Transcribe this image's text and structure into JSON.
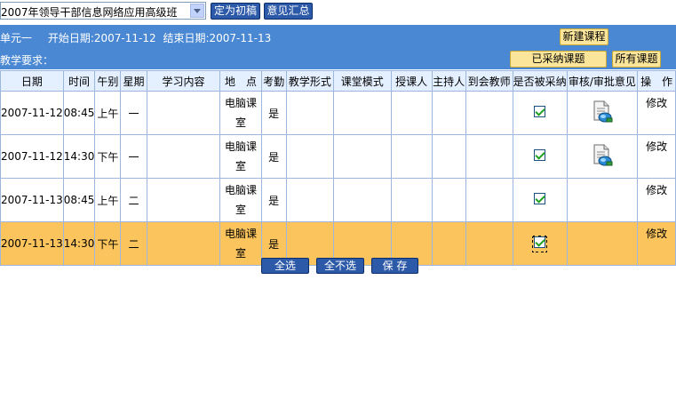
{
  "toolbar": {
    "class_select_value": "2007年领导干部信息网络应用高级班",
    "finalize_label": "定为初稿",
    "summary_label": "意见汇总"
  },
  "header": {
    "unit": "单元一",
    "start_label": "开始日期:2007-11-12",
    "end_label": "结束日期:2007-11-13",
    "requirement_label": "教学要求：",
    "new_course_label": "新建课程",
    "adopted_label": "已采纳课题",
    "all_label": "所有课题"
  },
  "table": {
    "columns": [
      "日期",
      "时间",
      "午别",
      "星期",
      "学习内容",
      "地　点",
      "考勤",
      "教学形式",
      "课堂模式",
      "授课人",
      "主持人",
      "到会教师",
      "是否被采纳",
      "审核/审批意见",
      "操　作"
    ],
    "rows": [
      {
        "date": "2007-11-12",
        "time": "08:45",
        "period": "上午",
        "weekday": "一",
        "content": "",
        "place": "电脑课室",
        "attendance": "是",
        "form": "",
        "mode": "",
        "lecturer": "",
        "host": "",
        "teachers": "",
        "adopted": true,
        "has_review": true,
        "action": "修改"
      },
      {
        "date": "2007-11-12",
        "time": "14:30",
        "period": "下午",
        "weekday": "一",
        "content": "",
        "place": "电脑课室",
        "attendance": "是",
        "form": "",
        "mode": "",
        "lecturer": "",
        "host": "",
        "teachers": "",
        "adopted": true,
        "has_review": true,
        "action": "修改"
      },
      {
        "date": "2007-11-13",
        "time": "08:45",
        "period": "上午",
        "weekday": "二",
        "content": "",
        "place": "电脑课室",
        "attendance": "是",
        "form": "",
        "mode": "",
        "lecturer": "",
        "host": "",
        "teachers": "",
        "adopted": true,
        "has_review": false,
        "action": "修改"
      },
      {
        "date": "2007-11-13",
        "time": "14:30",
        "period": "下午",
        "weekday": "二",
        "content": "",
        "place": "电脑课室",
        "attendance": "是",
        "form": "",
        "mode": "",
        "lecturer": "",
        "host": "",
        "teachers": "",
        "adopted": true,
        "has_review": false,
        "action": "修改",
        "selected": true
      }
    ]
  },
  "footer": {
    "select_all_label": "全选",
    "deselect_all_label": "全不选",
    "save_label": "保 存"
  },
  "colors": {
    "header_bg": "#4a88d4",
    "selected_row": "#fcc45c",
    "button_blue": "#2d5aa8",
    "button_yellow": "#fbe59a"
  }
}
